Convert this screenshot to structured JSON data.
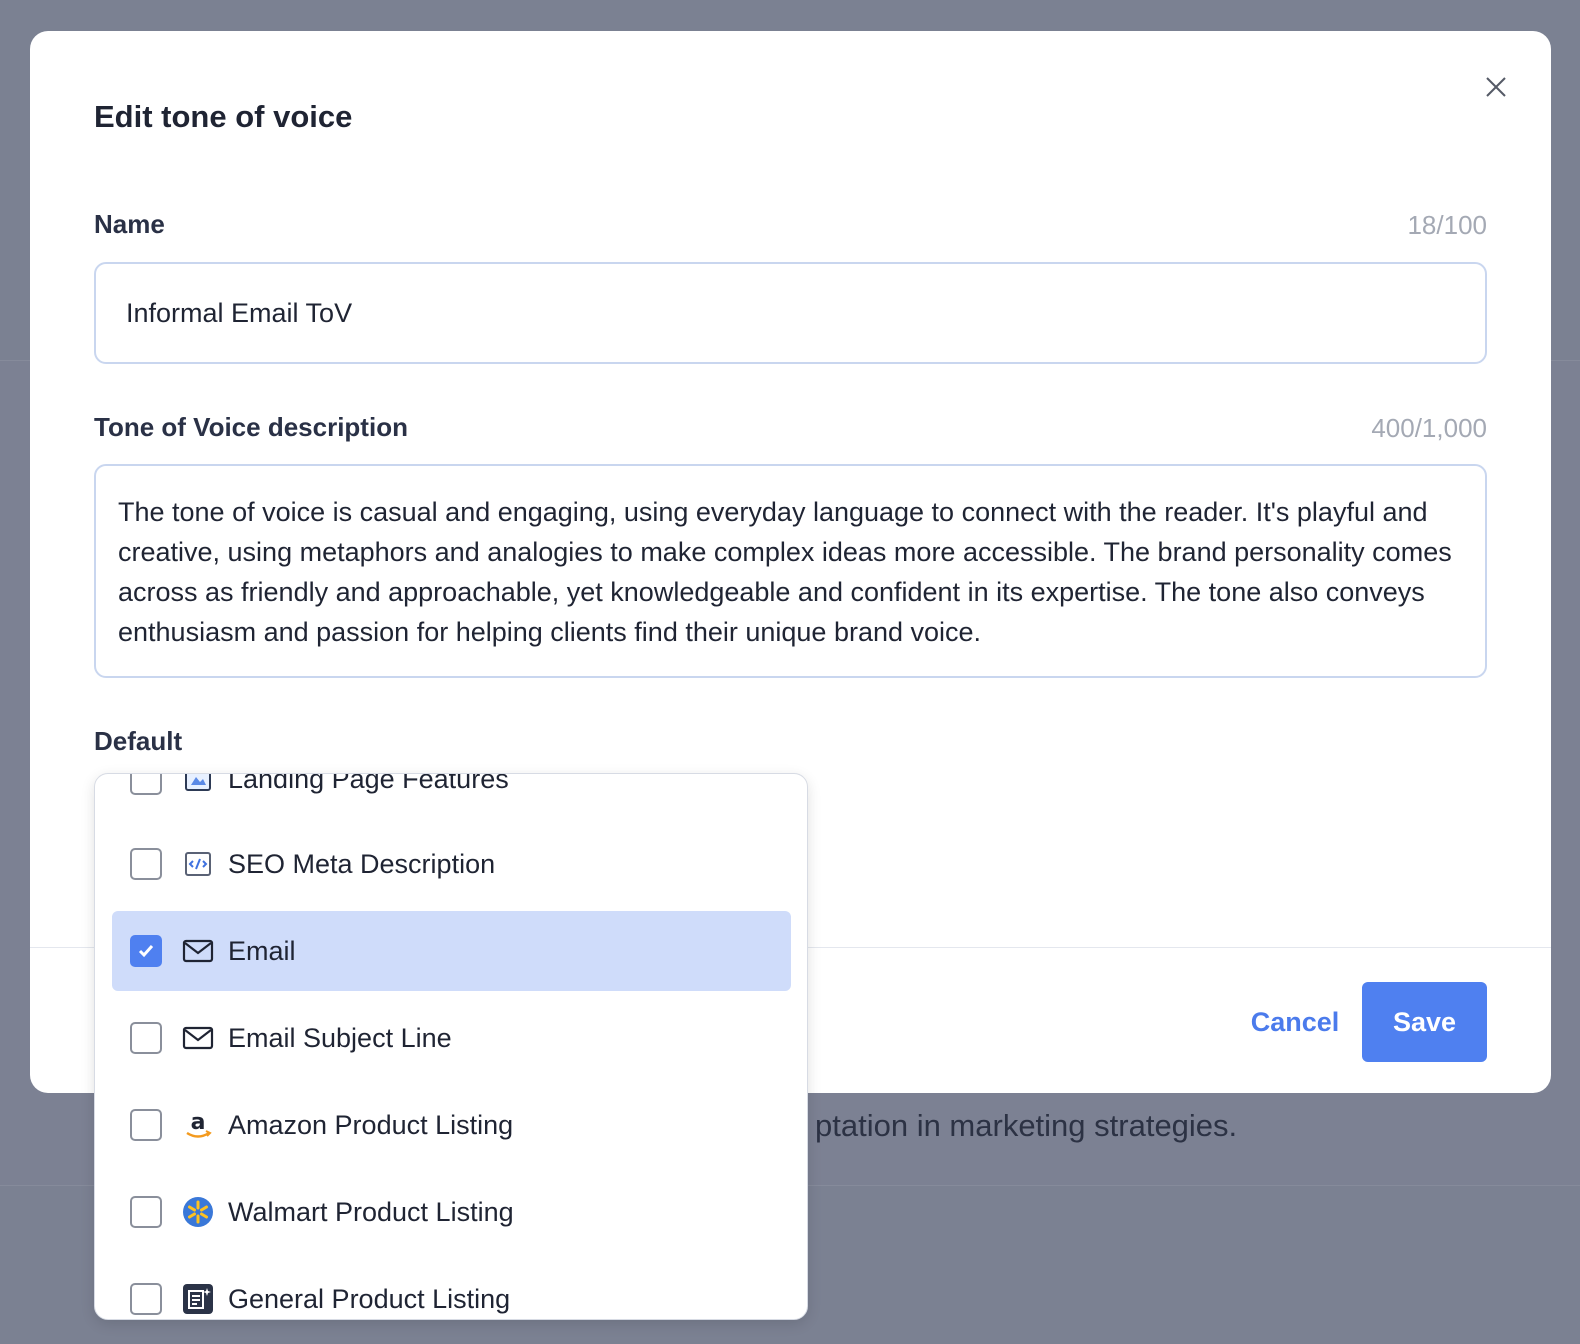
{
  "background": {
    "text": "ptation in marketing strategies."
  },
  "modal": {
    "title": "Edit tone of voice",
    "name": {
      "label": "Name",
      "counter": "18/100",
      "value": "Informal Email ToV"
    },
    "description": {
      "label": "Tone of Voice description",
      "counter": "400/1,000",
      "value": "The tone of voice is casual and engaging, using everyday language to connect with the reader. It's playful and creative, using metaphors and analogies to make complex ideas more accessible. The brand personality comes across as friendly and approachable, yet knowledgeable and confident in its expertise. The tone also conveys enthusiasm and passion for helping clients find their unique brand voice."
    },
    "default": {
      "label": "Default"
    },
    "footer": {
      "cancel_label": "Cancel",
      "save_label": "Save"
    }
  },
  "dropdown": {
    "options": [
      {
        "label": "Landing Page Features",
        "icon": "landing-page-icon",
        "checked": false
      },
      {
        "label": "SEO Meta Description",
        "icon": "code-chart-icon",
        "checked": false
      },
      {
        "label": "Email",
        "icon": "envelope-icon",
        "checked": true
      },
      {
        "label": "Email Subject Line",
        "icon": "envelope-icon",
        "checked": false
      },
      {
        "label": "Amazon Product Listing",
        "icon": "amazon-logo-icon",
        "checked": false
      },
      {
        "label": "Walmart Product Listing",
        "icon": "walmart-logo-icon",
        "checked": false
      },
      {
        "label": "General Product Listing",
        "icon": "product-listing-icon",
        "checked": false
      }
    ]
  },
  "colors": {
    "accent": "#4f80f0",
    "selected_bg": "#cfdcfa",
    "overlay": "#7b8192"
  }
}
